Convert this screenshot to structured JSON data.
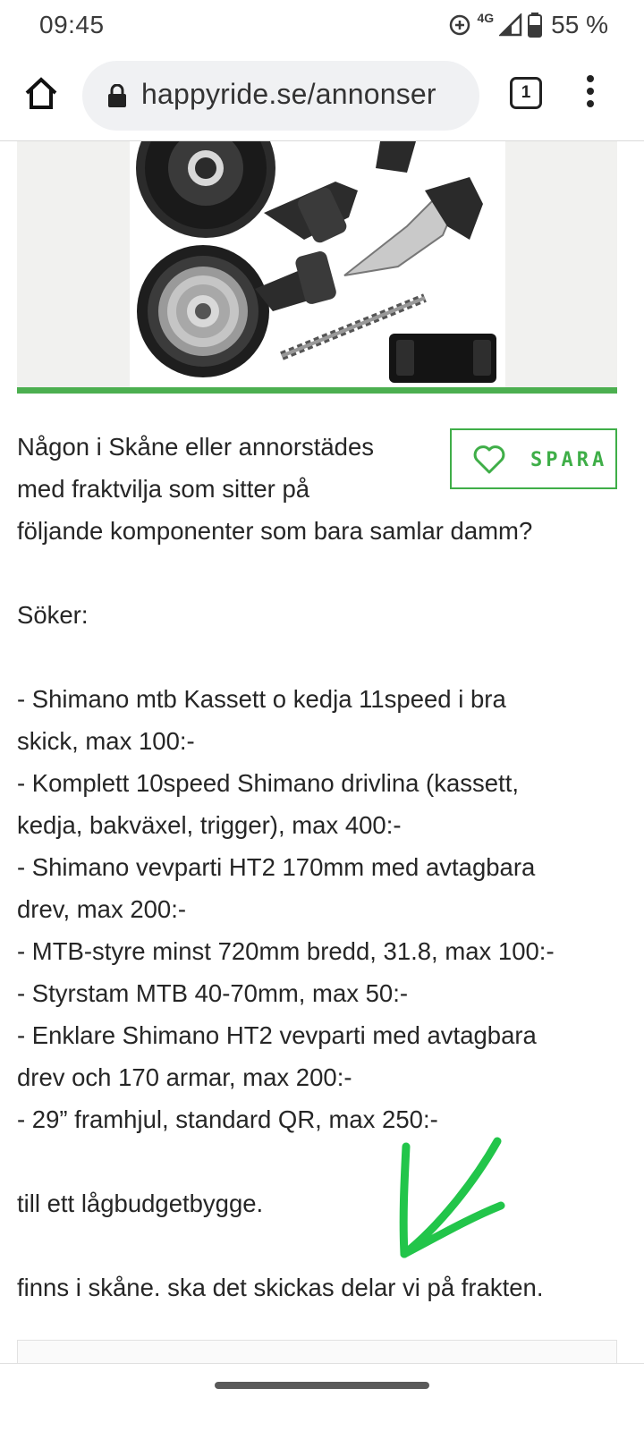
{
  "status_bar": {
    "time": "09:45",
    "network": "4G",
    "battery": "55 %",
    "icons": [
      "data-saver-icon",
      "signal-icon",
      "battery-icon"
    ]
  },
  "browser": {
    "url": "happyride.se/annonser",
    "tab_count": "1",
    "icons": [
      "home-icon",
      "lock-icon",
      "tab-switcher-icon",
      "overflow-menu-icon"
    ]
  },
  "listing": {
    "image_subject": "Shimano SLX components",
    "save_label": "SPARA",
    "intro_lines": [
      "Någon i Skåne eller annorstädes",
      "med fraktvilja som sitter på",
      "följande komponenter som bara samlar damm?"
    ],
    "heading": "Söker:",
    "items": [
      "- Shimano mtb Kassett o kedja 11speed i bra",
      "skick, max 100:-",
      "- Komplett 10speed Shimano drivlina (kassett,",
      "kedja, bakväxel, trigger), max 400:-",
      "- Shimano vevparti HT2 170mm med avtagbara",
      "drev, max 200:-",
      "- MTB-styre minst 720mm bredd, 31.8, max 100:-",
      "- Styrstam MTB 40-70mm, max 50:-",
      "- Enklare Shimano HT2 vevparti med avtagbara",
      "drev och 170 armar, max 200:-",
      "- 29” framhjul, standard QR, max 250:-"
    ],
    "purpose": "till ett lågbudgetbygge.",
    "location_note": "finns i skåne. ska det skickas delar vi på frakten."
  },
  "colors": {
    "accent_green": "#3fae48",
    "annotation_green": "#22c54a",
    "text": "#262626"
  }
}
